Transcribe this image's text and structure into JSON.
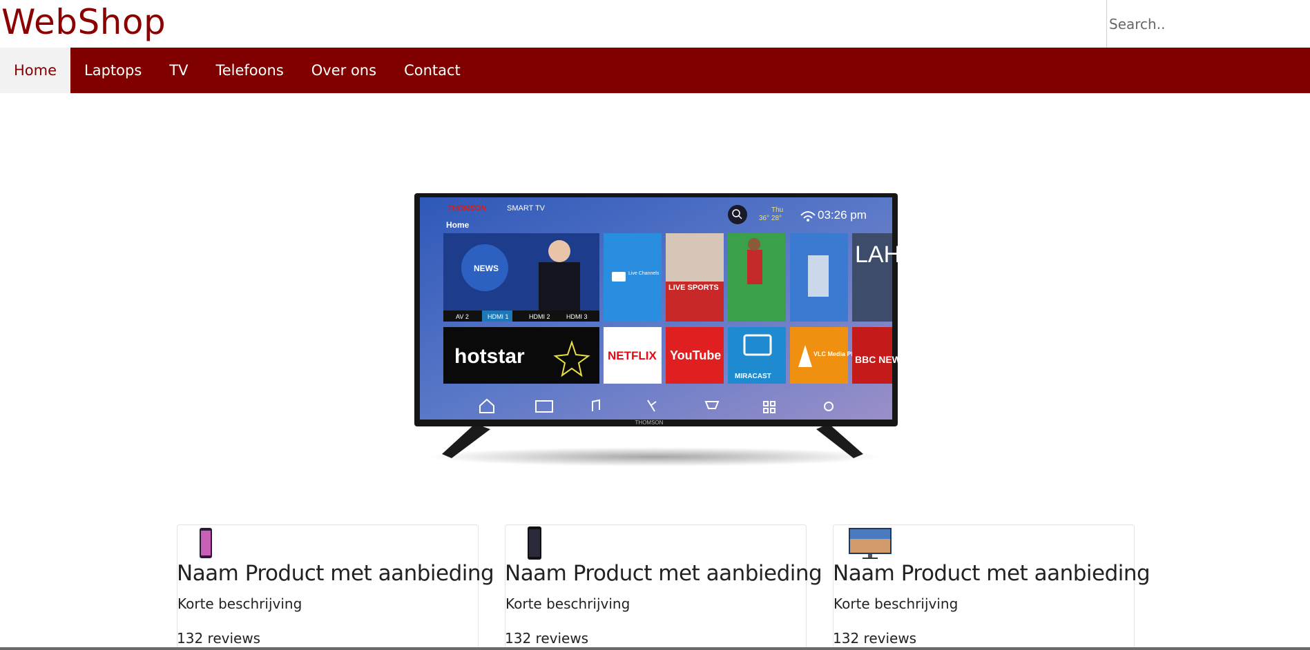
{
  "header": {
    "brand": "WebShop",
    "search_placeholder": "Search.."
  },
  "nav": {
    "items": [
      {
        "label": "Home",
        "active": true
      },
      {
        "label": "Laptops",
        "active": false
      },
      {
        "label": "TV",
        "active": false
      },
      {
        "label": "Telefoons",
        "active": false
      },
      {
        "label": "Over ons",
        "active": false
      },
      {
        "label": "Contact",
        "active": false
      }
    ]
  },
  "hero": {
    "tv_brand": "THOMSON",
    "tv_model_label": "SMART TV",
    "tv_home_label": "Home",
    "tv_weather_day": "Thu",
    "tv_weather_temps": "36° 28°",
    "tv_time": "03:26 pm",
    "tv_inputs": [
      "AV 2",
      "HDMI 1",
      "HDMI 2",
      "HDMI 3"
    ],
    "tv_tiles": [
      "NEWS",
      "Live Channels",
      "LIVE SPORTS",
      "hotstar",
      "NETFLIX",
      "YouTube",
      "MIRACAST",
      "VLC Media Player",
      "BBC NEWS"
    ],
    "tv_bezel_label": "THOMSON"
  },
  "products": [
    {
      "title": "Naam Product met aanbieding",
      "description": "Korte beschrijving",
      "reviews": "132 reviews",
      "thumb": "phone-pink"
    },
    {
      "title": "Naam Product met aanbieding",
      "description": "Korte beschrijving",
      "reviews": "132 reviews",
      "thumb": "phone-dark"
    },
    {
      "title": "Naam Product met aanbieding",
      "description": "Korte beschrijving",
      "reviews": "132 reviews",
      "thumb": "monitor"
    }
  ],
  "colors": {
    "brand": "#8b0000",
    "nav_bg": "#800000",
    "nav_active_bg": "#f2f2f2"
  }
}
